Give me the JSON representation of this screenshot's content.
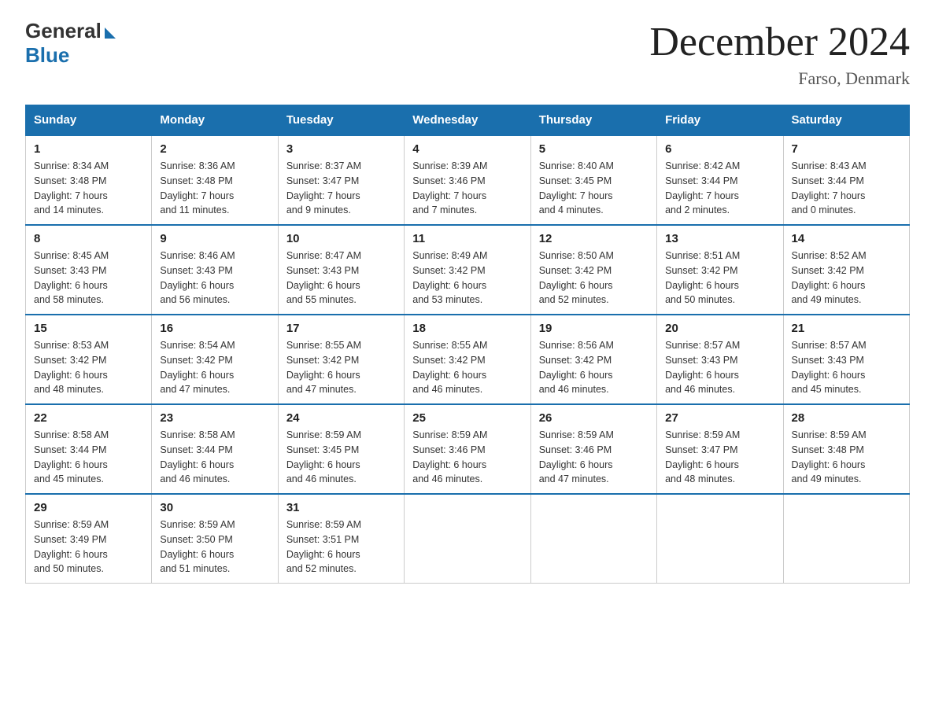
{
  "header": {
    "logo": {
      "general": "General",
      "blue": "Blue"
    },
    "title": "December 2024",
    "subtitle": "Farso, Denmark"
  },
  "days_of_week": [
    "Sunday",
    "Monday",
    "Tuesday",
    "Wednesday",
    "Thursday",
    "Friday",
    "Saturday"
  ],
  "weeks": [
    [
      {
        "day": "1",
        "sunrise": "Sunrise: 8:34 AM",
        "sunset": "Sunset: 3:48 PM",
        "daylight": "Daylight: 7 hours",
        "daylight2": "and 14 minutes."
      },
      {
        "day": "2",
        "sunrise": "Sunrise: 8:36 AM",
        "sunset": "Sunset: 3:48 PM",
        "daylight": "Daylight: 7 hours",
        "daylight2": "and 11 minutes."
      },
      {
        "day": "3",
        "sunrise": "Sunrise: 8:37 AM",
        "sunset": "Sunset: 3:47 PM",
        "daylight": "Daylight: 7 hours",
        "daylight2": "and 9 minutes."
      },
      {
        "day": "4",
        "sunrise": "Sunrise: 8:39 AM",
        "sunset": "Sunset: 3:46 PM",
        "daylight": "Daylight: 7 hours",
        "daylight2": "and 7 minutes."
      },
      {
        "day": "5",
        "sunrise": "Sunrise: 8:40 AM",
        "sunset": "Sunset: 3:45 PM",
        "daylight": "Daylight: 7 hours",
        "daylight2": "and 4 minutes."
      },
      {
        "day": "6",
        "sunrise": "Sunrise: 8:42 AM",
        "sunset": "Sunset: 3:44 PM",
        "daylight": "Daylight: 7 hours",
        "daylight2": "and 2 minutes."
      },
      {
        "day": "7",
        "sunrise": "Sunrise: 8:43 AM",
        "sunset": "Sunset: 3:44 PM",
        "daylight": "Daylight: 7 hours",
        "daylight2": "and 0 minutes."
      }
    ],
    [
      {
        "day": "8",
        "sunrise": "Sunrise: 8:45 AM",
        "sunset": "Sunset: 3:43 PM",
        "daylight": "Daylight: 6 hours",
        "daylight2": "and 58 minutes."
      },
      {
        "day": "9",
        "sunrise": "Sunrise: 8:46 AM",
        "sunset": "Sunset: 3:43 PM",
        "daylight": "Daylight: 6 hours",
        "daylight2": "and 56 minutes."
      },
      {
        "day": "10",
        "sunrise": "Sunrise: 8:47 AM",
        "sunset": "Sunset: 3:43 PM",
        "daylight": "Daylight: 6 hours",
        "daylight2": "and 55 minutes."
      },
      {
        "day": "11",
        "sunrise": "Sunrise: 8:49 AM",
        "sunset": "Sunset: 3:42 PM",
        "daylight": "Daylight: 6 hours",
        "daylight2": "and 53 minutes."
      },
      {
        "day": "12",
        "sunrise": "Sunrise: 8:50 AM",
        "sunset": "Sunset: 3:42 PM",
        "daylight": "Daylight: 6 hours",
        "daylight2": "and 52 minutes."
      },
      {
        "day": "13",
        "sunrise": "Sunrise: 8:51 AM",
        "sunset": "Sunset: 3:42 PM",
        "daylight": "Daylight: 6 hours",
        "daylight2": "and 50 minutes."
      },
      {
        "day": "14",
        "sunrise": "Sunrise: 8:52 AM",
        "sunset": "Sunset: 3:42 PM",
        "daylight": "Daylight: 6 hours",
        "daylight2": "and 49 minutes."
      }
    ],
    [
      {
        "day": "15",
        "sunrise": "Sunrise: 8:53 AM",
        "sunset": "Sunset: 3:42 PM",
        "daylight": "Daylight: 6 hours",
        "daylight2": "and 48 minutes."
      },
      {
        "day": "16",
        "sunrise": "Sunrise: 8:54 AM",
        "sunset": "Sunset: 3:42 PM",
        "daylight": "Daylight: 6 hours",
        "daylight2": "and 47 minutes."
      },
      {
        "day": "17",
        "sunrise": "Sunrise: 8:55 AM",
        "sunset": "Sunset: 3:42 PM",
        "daylight": "Daylight: 6 hours",
        "daylight2": "and 47 minutes."
      },
      {
        "day": "18",
        "sunrise": "Sunrise: 8:55 AM",
        "sunset": "Sunset: 3:42 PM",
        "daylight": "Daylight: 6 hours",
        "daylight2": "and 46 minutes."
      },
      {
        "day": "19",
        "sunrise": "Sunrise: 8:56 AM",
        "sunset": "Sunset: 3:42 PM",
        "daylight": "Daylight: 6 hours",
        "daylight2": "and 46 minutes."
      },
      {
        "day": "20",
        "sunrise": "Sunrise: 8:57 AM",
        "sunset": "Sunset: 3:43 PM",
        "daylight": "Daylight: 6 hours",
        "daylight2": "and 46 minutes."
      },
      {
        "day": "21",
        "sunrise": "Sunrise: 8:57 AM",
        "sunset": "Sunset: 3:43 PM",
        "daylight": "Daylight: 6 hours",
        "daylight2": "and 45 minutes."
      }
    ],
    [
      {
        "day": "22",
        "sunrise": "Sunrise: 8:58 AM",
        "sunset": "Sunset: 3:44 PM",
        "daylight": "Daylight: 6 hours",
        "daylight2": "and 45 minutes."
      },
      {
        "day": "23",
        "sunrise": "Sunrise: 8:58 AM",
        "sunset": "Sunset: 3:44 PM",
        "daylight": "Daylight: 6 hours",
        "daylight2": "and 46 minutes."
      },
      {
        "day": "24",
        "sunrise": "Sunrise: 8:59 AM",
        "sunset": "Sunset: 3:45 PM",
        "daylight": "Daylight: 6 hours",
        "daylight2": "and 46 minutes."
      },
      {
        "day": "25",
        "sunrise": "Sunrise: 8:59 AM",
        "sunset": "Sunset: 3:46 PM",
        "daylight": "Daylight: 6 hours",
        "daylight2": "and 46 minutes."
      },
      {
        "day": "26",
        "sunrise": "Sunrise: 8:59 AM",
        "sunset": "Sunset: 3:46 PM",
        "daylight": "Daylight: 6 hours",
        "daylight2": "and 47 minutes."
      },
      {
        "day": "27",
        "sunrise": "Sunrise: 8:59 AM",
        "sunset": "Sunset: 3:47 PM",
        "daylight": "Daylight: 6 hours",
        "daylight2": "and 48 minutes."
      },
      {
        "day": "28",
        "sunrise": "Sunrise: 8:59 AM",
        "sunset": "Sunset: 3:48 PM",
        "daylight": "Daylight: 6 hours",
        "daylight2": "and 49 minutes."
      }
    ],
    [
      {
        "day": "29",
        "sunrise": "Sunrise: 8:59 AM",
        "sunset": "Sunset: 3:49 PM",
        "daylight": "Daylight: 6 hours",
        "daylight2": "and 50 minutes."
      },
      {
        "day": "30",
        "sunrise": "Sunrise: 8:59 AM",
        "sunset": "Sunset: 3:50 PM",
        "daylight": "Daylight: 6 hours",
        "daylight2": "and 51 minutes."
      },
      {
        "day": "31",
        "sunrise": "Sunrise: 8:59 AM",
        "sunset": "Sunset: 3:51 PM",
        "daylight": "Daylight: 6 hours",
        "daylight2": "and 52 minutes."
      },
      {
        "day": "",
        "sunrise": "",
        "sunset": "",
        "daylight": "",
        "daylight2": ""
      },
      {
        "day": "",
        "sunrise": "",
        "sunset": "",
        "daylight": "",
        "daylight2": ""
      },
      {
        "day": "",
        "sunrise": "",
        "sunset": "",
        "daylight": "",
        "daylight2": ""
      },
      {
        "day": "",
        "sunrise": "",
        "sunset": "",
        "daylight": "",
        "daylight2": ""
      }
    ]
  ]
}
